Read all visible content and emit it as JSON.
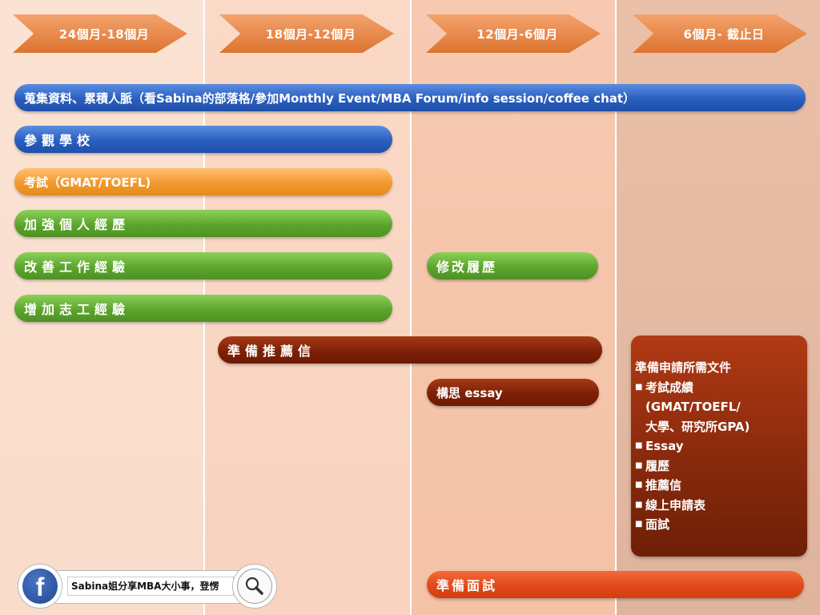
{
  "phases": [
    "24個月-18個月",
    "18個月-12個月",
    "12個月-6個月",
    "6個月- 截止日"
  ],
  "bars": {
    "collect": "蒐集資料、累積人脈（看Sabina的部落格/參加Monthly Event/MBA Forum/info session/coffee chat）",
    "visit": "參觀學校",
    "exam": "考試（GMAT/TOEFL)",
    "resume_build": "加強個人經歷",
    "work": "改善工作經驗",
    "volunteer": "增加志工經驗",
    "resume_edit": "修改履歷",
    "recommend": "準備推薦信",
    "essay": "構思 essay",
    "interview": "準備面試"
  },
  "documents": {
    "title": "準備申請所需文件",
    "items": [
      [
        "考試成績",
        "(GMAT/TOEFL/",
        "大學、研究所GPA)"
      ],
      [
        "Essay"
      ],
      [
        "履歷"
      ],
      [
        "推薦信"
      ],
      [
        "線上申請表"
      ],
      [
        "面試"
      ]
    ]
  },
  "footer": {
    "facebook_letter": "f",
    "search_text": "Sabina姐分享MBA大小事，登愣"
  },
  "colors": {
    "phase_arrow": "#e4843f",
    "blue": "#2a5ebf",
    "orange": "#f29a2f",
    "green": "#5da52d",
    "maroon": "#7d2007",
    "red": "#e24a1a"
  },
  "icons": [
    "facebook-icon",
    "search-icon"
  ]
}
